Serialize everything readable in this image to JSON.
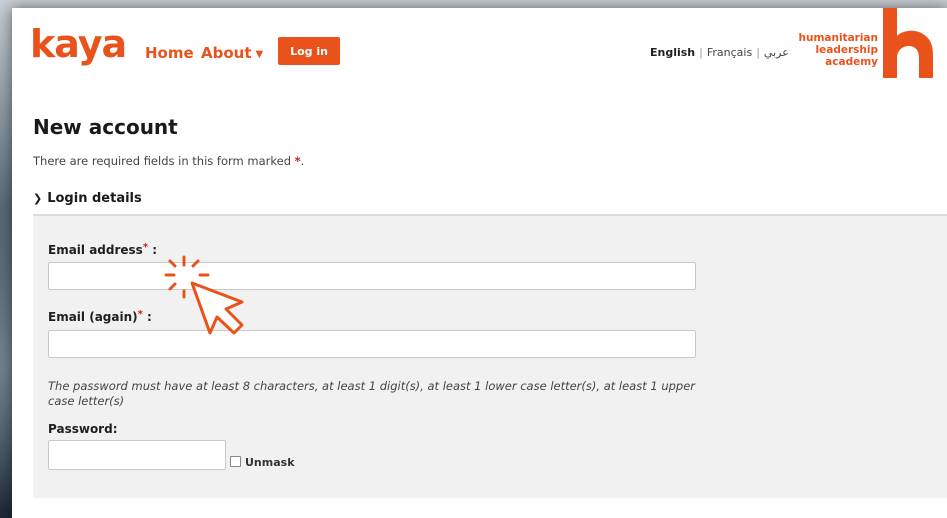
{
  "brand": {
    "logo_text": "kaya",
    "accent_color": "#e9531b"
  },
  "nav": {
    "home_label": "Home",
    "about_label": "About",
    "about_icon": "chevron-down-icon",
    "login_label": "Log in"
  },
  "language": {
    "english": "English",
    "french": "Français",
    "arabic": "عربي",
    "separator": "|"
  },
  "partner": {
    "line1": "humanitarian",
    "line2": "leadership",
    "line3": "academy",
    "mark_letter": "h"
  },
  "page": {
    "title": "New account",
    "required_note": "There are required fields in this form marked",
    "required_star": "*",
    "required_note_end": "."
  },
  "section": {
    "toggle_icon": "chevron-down-icon",
    "title": "Login details"
  },
  "form": {
    "email_label": "Email address",
    "email_value": "",
    "email_again_label": "Email (again)",
    "email_again_value": "",
    "required_star": "*",
    "label_colon": ":",
    "password_hint": "The password must have at least 8 characters, at least 1 digit(s), at least 1 lower case letter(s), at least 1 upper case letter(s)",
    "password_label": "Password:",
    "password_value": "",
    "unmask_label": "Unmask",
    "unmask_checked": false
  },
  "overlay": {
    "cursor_icon": "click-pointer-icon",
    "cursor_color": "#e9531b"
  }
}
